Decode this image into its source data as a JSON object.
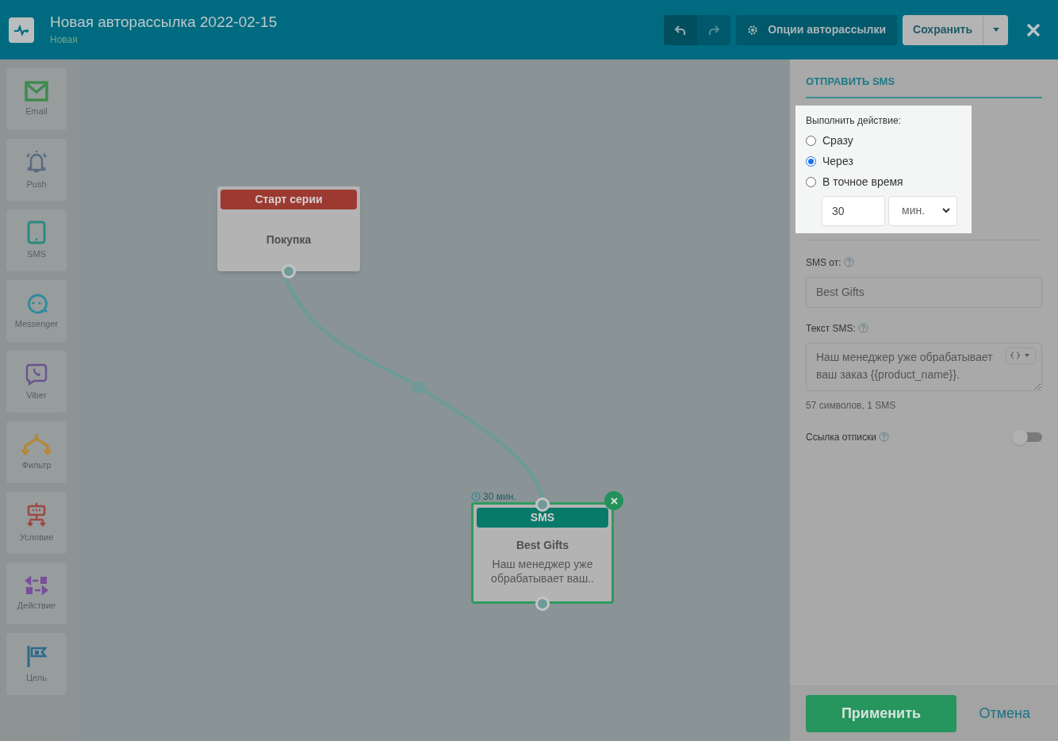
{
  "header": {
    "title": "Новая авторассылка 2022-02-15",
    "status": "Новая",
    "options_button": "Опции авторассылки",
    "save_button": "Сохранить"
  },
  "palette": [
    {
      "label": "Email",
      "kind": "email"
    },
    {
      "label": "Push",
      "kind": "push"
    },
    {
      "label": "SMS",
      "kind": "sms"
    },
    {
      "label": "Messenger",
      "kind": "messenger"
    },
    {
      "label": "Viber",
      "kind": "viber"
    },
    {
      "label": "Фильтр",
      "kind": "filter"
    },
    {
      "label": "Условие",
      "kind": "condition"
    },
    {
      "label": "Действие",
      "kind": "action"
    },
    {
      "label": "Цель",
      "kind": "goal"
    }
  ],
  "canvas": {
    "nodes": [
      {
        "kind": "start",
        "header": "Старт серии",
        "title": "Покупка",
        "selected": false
      },
      {
        "kind": "sms",
        "header": "SMS",
        "title": "Best Gifts",
        "text": "Наш менеджер уже обрабатывает ваш..",
        "delay": "30 мин.",
        "selected": true
      }
    ]
  },
  "panel": {
    "title": "ОТПРАВИТЬ SMS",
    "timing_label": "Выполнить действие:",
    "timing_options": [
      {
        "label": "Сразу",
        "selected": false
      },
      {
        "label": "Через",
        "selected": true
      },
      {
        "label": "В точное время",
        "selected": false
      }
    ],
    "delay_value": "30",
    "delay_unit": "мин.",
    "sender_label": "SMS от:",
    "sender_value": "Best Gifts",
    "text_label": "Текст SMS:",
    "text_value": "Наш менеджер уже обрабатывает ваш заказ {{product_name}}.",
    "counter": "57 символов, 1 SMS",
    "unsubscribe_label": "Ссылка отписки",
    "unsubscribe_on": false,
    "apply_button": "Применить",
    "cancel_button": "Отмена"
  }
}
